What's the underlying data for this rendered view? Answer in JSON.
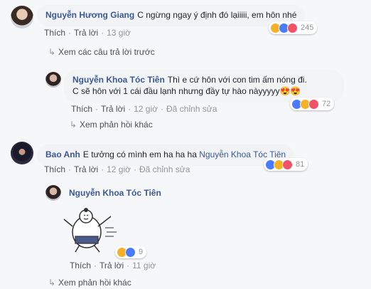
{
  "comments": {
    "c1": {
      "author": "Nguyễn Hương Giang",
      "text": "C ngừng ngay ý định đó lạiiiii, em hôn nhé",
      "like": "Thích",
      "reply": "Trả lời",
      "time": "13 giờ",
      "reactions": "245"
    },
    "prev_link": "Xem các câu trả lời trước",
    "c2": {
      "author": "Nguyễn Khoa Tóc Tiên",
      "text_line1": "Thì e cứ hôn với con tim ấm nóng đi.",
      "text_line2": "C sẽ hôn với 1 cái đầu lạnh nhưng đầy tự hào nàyyyyy😍😍",
      "like": "Thích",
      "reply": "Trả lời",
      "time": "12 giờ",
      "edited": "Đã chỉnh sửa",
      "reactions": "72"
    },
    "more_link1": "Xem phản hồi khác",
    "c3": {
      "author": "Bao Anh",
      "text": "E tưởng có mình em ha ha ha",
      "mention": "Nguyễn Khoa Tóc Tiên",
      "like": "Thích",
      "reply": "Trả lời",
      "time": "12 giờ",
      "edited": "Đã chỉnh sửa",
      "reactions": "81"
    },
    "c4": {
      "author": "Nguyễn Khoa Tóc Tiên",
      "like": "Thích",
      "reply": "Trả lời",
      "time": "11 giờ",
      "reactions": "9"
    },
    "more_link2": "Xem phản hồi khác"
  },
  "colors": {
    "link": "#385898",
    "like": "#4a7aff",
    "haha": "#f7b125",
    "love": "#f25268"
  }
}
